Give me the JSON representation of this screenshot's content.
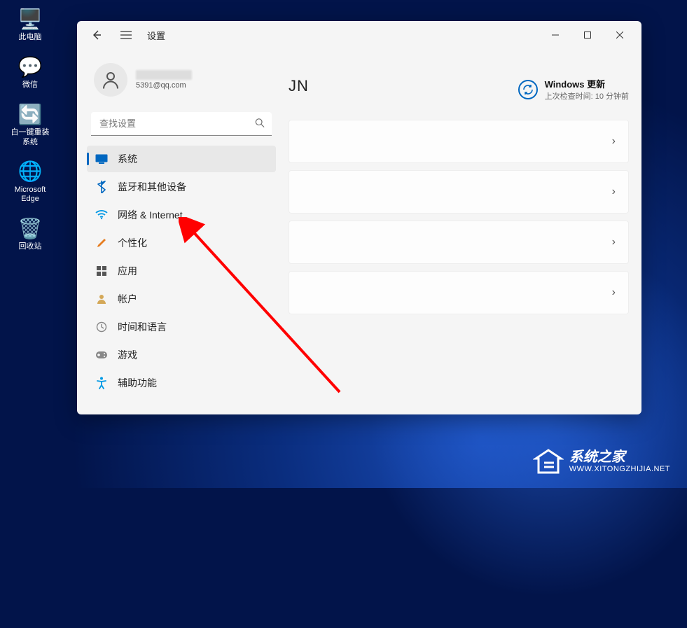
{
  "desktop": {
    "icons": [
      {
        "label": "此电脑",
        "glyph": "🖥️",
        "name": "desktop-icon-this-pc"
      },
      {
        "label": "微信",
        "glyph": "💬",
        "name": "desktop-icon-wechat"
      },
      {
        "label": "白一键重装\n系统",
        "glyph": "🔄",
        "name": "desktop-icon-reinstall"
      },
      {
        "label": "Microsoft\nEdge",
        "glyph": "🌐",
        "name": "desktop-icon-edge"
      },
      {
        "label": "回收站",
        "glyph": "🗑️",
        "name": "desktop-icon-recycle"
      }
    ]
  },
  "window": {
    "title": "设置",
    "user": {
      "name": "",
      "email": "5391@qq.com"
    },
    "search_placeholder": "查找设置",
    "nav": [
      {
        "label": "系统",
        "icon": "system",
        "color": "#0067c0",
        "name": "nav-system"
      },
      {
        "label": "蓝牙和其他设备",
        "icon": "bluetooth",
        "color": "#0067c0",
        "name": "nav-bluetooth"
      },
      {
        "label": "网络 & Internet",
        "icon": "wifi",
        "color": "#0099e5",
        "name": "nav-network"
      },
      {
        "label": "个性化",
        "icon": "brush",
        "color": "#e67e22",
        "name": "nav-personalization"
      },
      {
        "label": "应用",
        "icon": "apps",
        "color": "#555",
        "name": "nav-apps"
      },
      {
        "label": "帐户",
        "icon": "account",
        "color": "#d4a858",
        "name": "nav-accounts"
      },
      {
        "label": "时间和语言",
        "icon": "time",
        "color": "#888",
        "name": "nav-time"
      },
      {
        "label": "游戏",
        "icon": "gaming",
        "color": "#888",
        "name": "nav-gaming"
      },
      {
        "label": "辅助功能",
        "icon": "accessibility",
        "color": "#0099e5",
        "name": "nav-accessibility"
      }
    ],
    "active_nav_index": 0,
    "main": {
      "title": "JN",
      "update": {
        "title": "Windows 更新",
        "subtitle": "上次检查时间: 10 分钟前"
      }
    }
  },
  "watermark": {
    "cn": "系统之家",
    "en": "WWW.XITONGZHIJIA.NET"
  }
}
